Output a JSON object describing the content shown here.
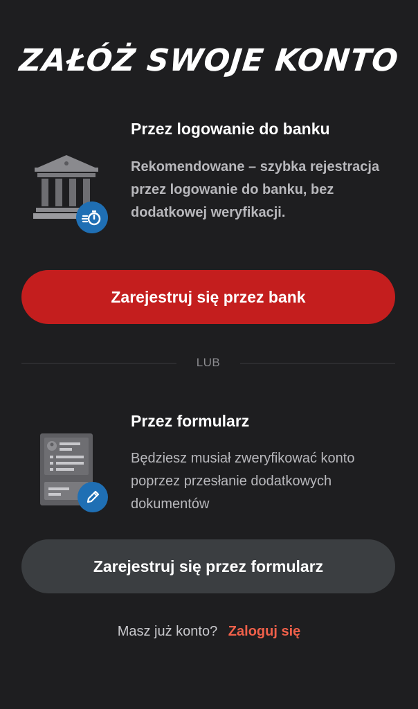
{
  "title": "ZAŁÓŻ SWOJE KONTO",
  "bank_section": {
    "icon": "bank-building-icon",
    "badge_icon": "fast-stopwatch-icon",
    "heading": "Przez logowanie do banku",
    "description": "Rekomendowane – szybka rejestracja przez logowanie do banku, bez dodatkowej weryfikacji.",
    "button_label": "Zarejestruj się przez bank"
  },
  "divider_label": "LUB",
  "form_section": {
    "icon": "form-document-icon",
    "badge_icon": "pencil-icon",
    "heading": "Przez formularz",
    "description": "Będziesz musiał zweryfikować konto poprzez przesłanie dodatkowych dokumentów",
    "button_label": "Zarejestruj się przez formularz"
  },
  "login": {
    "question": "Masz już konto?",
    "link_label": "Zaloguj się"
  },
  "colors": {
    "background": "#1e1e20",
    "primary_button": "#c41e1e",
    "secondary_button": "#3b3e41",
    "link": "#f0604a",
    "badge": "#1f6fb4"
  }
}
